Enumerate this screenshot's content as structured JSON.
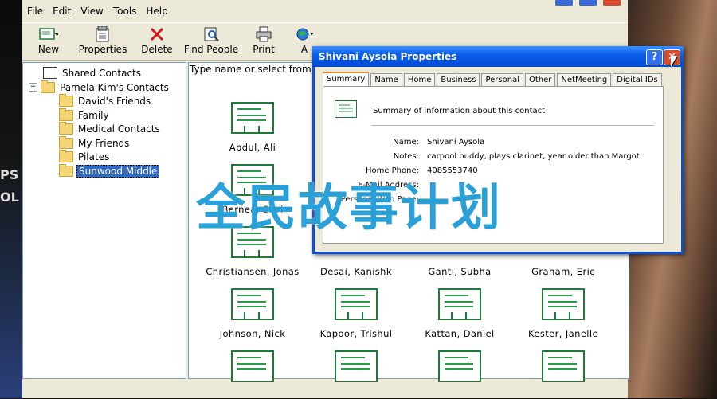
{
  "menubar": [
    "File",
    "Edit",
    "View",
    "Tools",
    "Help"
  ],
  "toolbar": {
    "new": "New",
    "properties": "Properties",
    "delete": "Delete",
    "find_people": "Find People",
    "print": "Print",
    "action_partial": "A"
  },
  "tree": {
    "shared": "Shared Contacts",
    "pamela": "Pamela Kim's Contacts",
    "folders": [
      "David's Friends",
      "Family",
      "Medical Contacts",
      "My Friends",
      "Pilates",
      "Sunwood Middle"
    ]
  },
  "contacts_pane": {
    "prompt": "Type name or select from list:"
  },
  "contacts": [
    "Abdul, Ali",
    "Bernea, Silvi",
    "Christiansen, Jonas",
    "Desai, Kanishk",
    "Ganti, Subha",
    "Graham, Eric",
    "Johnson, Nick",
    "Kapoor, Trishul",
    "Kattan, Daniel",
    "Kester, Janelle"
  ],
  "dialog": {
    "title": "Shivani Aysola Properties",
    "help_glyph": "?",
    "close_glyph": "✕",
    "tabs": [
      "Summary",
      "Name",
      "Home",
      "Business",
      "Personal",
      "Other",
      "NetMeeting",
      "Digital IDs"
    ],
    "summary_heading": "Summary of information about this contact",
    "fields": [
      {
        "label": "Name:",
        "value": "Shivani Aysola"
      },
      {
        "label": "Notes:",
        "value": "carpool buddy, plays clarinet, year older than Margot"
      },
      {
        "label": "Home Phone:",
        "value": "4085553740"
      },
      {
        "label": "E-Mail Address:",
        "value": ""
      },
      {
        "label": "Personal Web Page:",
        "value": ""
      }
    ]
  },
  "watermark": "全民故事计划",
  "left_edge_text": [
    "PS",
    "OL"
  ],
  "colors": {
    "selection": "#316ac5",
    "titlebar": "#0a5fe8",
    "watermark": "#2aa0d8"
  }
}
